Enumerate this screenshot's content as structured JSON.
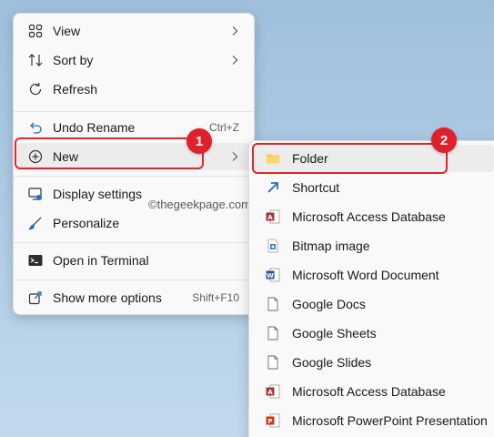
{
  "main_menu": {
    "items": [
      {
        "label": "View",
        "icon": "grid-view-icon"
      },
      {
        "label": "Sort by",
        "icon": "sort-icon"
      },
      {
        "label": "Refresh",
        "icon": "refresh-icon"
      },
      {
        "label": "Undo Rename",
        "icon": "undo-icon",
        "shortcut": "Ctrl+Z"
      },
      {
        "label": "New",
        "icon": "plus-circle-icon"
      },
      {
        "label": "Display settings",
        "icon": "display-settings-icon"
      },
      {
        "label": "Personalize",
        "icon": "brush-icon"
      },
      {
        "label": "Open in Terminal",
        "icon": "terminal-icon"
      },
      {
        "label": "Show more options",
        "icon": "share-icon",
        "shortcut": "Shift+F10"
      }
    ]
  },
  "sub_menu": {
    "items": [
      {
        "label": "Folder",
        "icon": "folder-icon"
      },
      {
        "label": "Shortcut",
        "icon": "shortcut-arrow-icon"
      },
      {
        "label": "Microsoft Access Database",
        "icon": "access-icon"
      },
      {
        "label": "Bitmap image",
        "icon": "bitmap-icon"
      },
      {
        "label": "Microsoft Word Document",
        "icon": "word-icon"
      },
      {
        "label": "Google Docs",
        "icon": "document-icon"
      },
      {
        "label": "Google Sheets",
        "icon": "document-icon"
      },
      {
        "label": "Google Slides",
        "icon": "document-icon"
      },
      {
        "label": "Microsoft Access Database",
        "icon": "access-icon"
      },
      {
        "label": "Microsoft PowerPoint Presentation",
        "icon": "powerpoint-icon"
      }
    ]
  },
  "watermark": "©thegeekpage.com",
  "annotations": {
    "badge_1": "1",
    "badge_2": "2",
    "color": "#e3242b"
  }
}
